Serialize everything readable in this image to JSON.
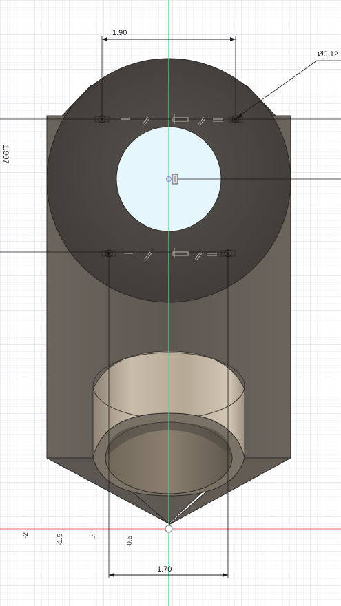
{
  "colors": {
    "background": "#ffffff",
    "grid_minor": "#e9eef3",
    "grid_major": "#d3dbe3",
    "y_axis": "#52d48a",
    "x_axis": "#e06a6a",
    "body_face": "#5f5a54",
    "cylinder_top": "#4a4641",
    "bore": "#e6f6fd",
    "boss": "#b7ab9a",
    "dimension_line": "#1a1a1a"
  },
  "dimensions": {
    "top_width": "1.90",
    "hole_diameter": "Ø0.12",
    "vertical_spacing": "1.907",
    "bottom_width": "1.70"
  },
  "axis_ticks": [
    "-2",
    "-1.5",
    "-1",
    "-0.5"
  ],
  "icons": {
    "hole_marker": "hole-center-icon",
    "origin_marker": "origin-icon",
    "constraint_marker": "constraint-icon"
  }
}
